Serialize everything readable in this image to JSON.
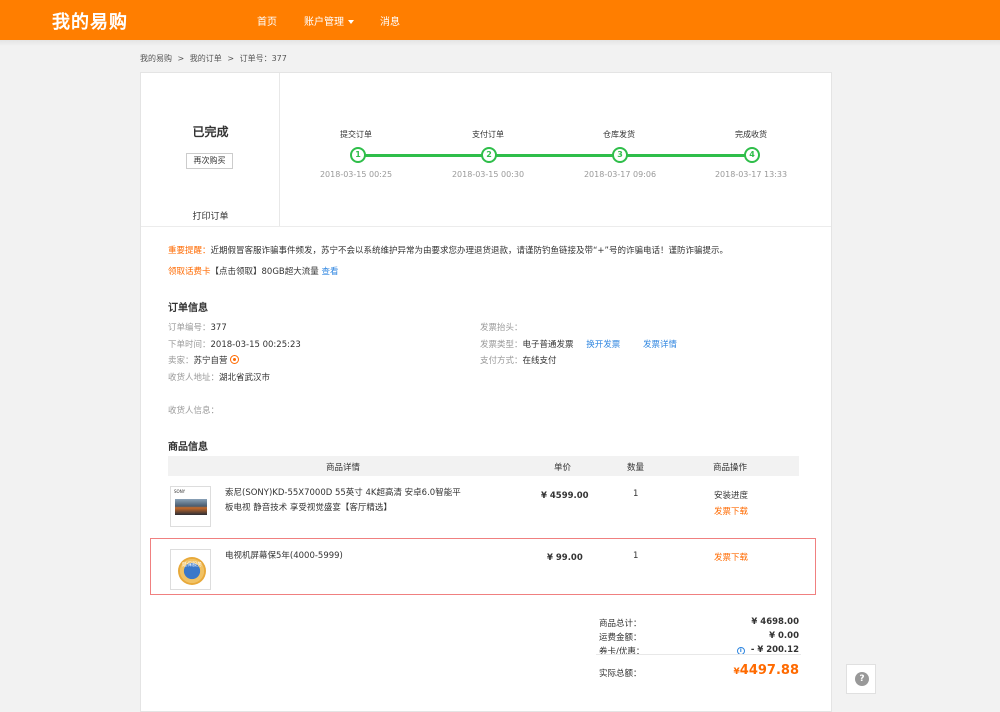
{
  "header": {
    "logo": "我的易购",
    "nav": [
      "首页",
      "账户管理",
      "消息"
    ]
  },
  "breadcrumb": [
    "我的易购",
    ">",
    "我的订单",
    ">",
    "订单号：377"
  ],
  "status": {
    "title": "已完成",
    "rebuy": "再次购买",
    "print": "打印订单"
  },
  "steps": [
    {
      "label": "提交订单",
      "num": "1",
      "time": "2018-03-15 00:25"
    },
    {
      "label": "支付订单",
      "num": "2",
      "time": "2018-03-15 00:30"
    },
    {
      "label": "仓库发货",
      "num": "3",
      "time": "2018-03-17 09:06"
    },
    {
      "label": "完成收货",
      "num": "4",
      "time": "2018-03-17 13:33"
    }
  ],
  "notice": {
    "prefix": "重要提醒：",
    "text": "近期假冒客服诈骗事件频发，苏宁不会以系统维护异常为由要求您办理退货退款，请谨防钓鱼链接及带“+”号的诈骗电话！谨防诈骗提示。",
    "promo_prefix": "领取话费卡",
    "promo_text": "【点击领取】80GB超大流量",
    "promo_link": "查看"
  },
  "order_info": {
    "title": "订单信息",
    "number_label": "订单编号：",
    "number": "377",
    "time_label": "下单时间：",
    "time": "2018-03-15 00:25:23",
    "seller_label": "卖家：",
    "seller": "苏宁自营",
    "address_label": "收货人地址：",
    "address": "湖北省武汉市",
    "receiver_label": "收货人信息：",
    "invoice_title_label": "发票抬头：",
    "invoice_type_label": "发票类型：",
    "invoice_type": "电子普通发票",
    "invoice_change": "换开发票",
    "invoice_detail": "发票详情",
    "pay_label": "支付方式：",
    "pay": "在线支付"
  },
  "goods": {
    "title": "商品信息",
    "headers": [
      "商品详情",
      "单价",
      "数量",
      "商品操作"
    ],
    "items": [
      {
        "name_line1": "索尼(SONY)KD-55X7000D 55英寸 4K超高清 安卓6.0智能平",
        "name_line2": "板电视 静音技术 享受视觉盛宴【客厅精选】",
        "price": "¥ 4599.00",
        "qty": "1",
        "op1": "安装进度",
        "op2": "发票下载",
        "img_brand": "SONY"
      },
      {
        "name_line1": "电视机屏幕保5年(4000-5999)",
        "price": "¥ 99.00",
        "qty": "1",
        "op2": "发票下载",
        "img_text": "延保服务"
      }
    ]
  },
  "summary": {
    "goods_total_label": "商品总计：",
    "goods_total": "¥ 4698.00",
    "shipping_label": "运费金额：",
    "shipping": "¥ 0.00",
    "coupon_label": "券卡/优惠：",
    "coupon": "- ¥ 200.12",
    "actual_label": "实际总额：",
    "actual_cur": "¥",
    "actual": "4497.88"
  },
  "help": "?"
}
